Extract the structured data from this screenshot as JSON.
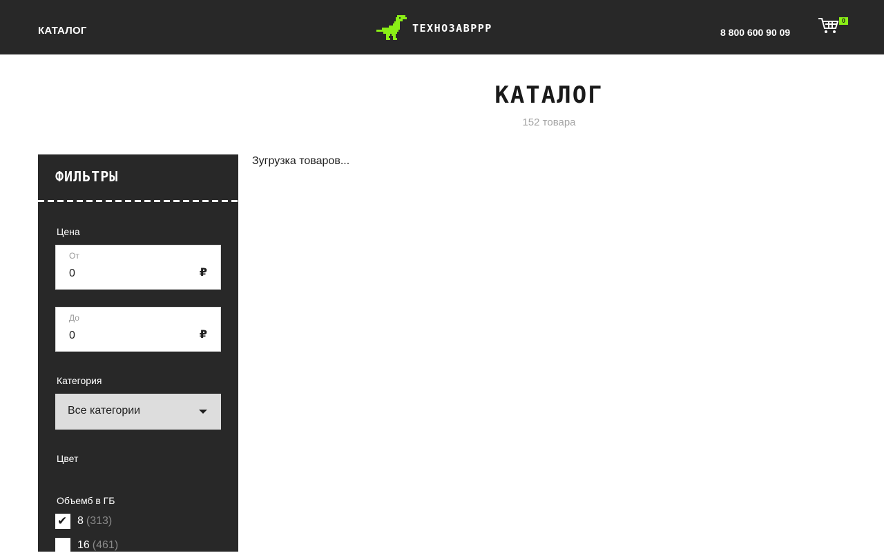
{
  "header": {
    "nav_catalog": "КАТАЛОГ",
    "logo_text": "ТЕХНОЗАВРРР",
    "logo_icon": "dinosaur-icon",
    "phone": "8 800 600 90 09",
    "cart_icon": "cart-icon",
    "cart_count": "0"
  },
  "main": {
    "title": "КАТАЛОГ",
    "count": "152 товара",
    "loading_text": "Зугрузка товаров..."
  },
  "filters": {
    "title": "ФИЛЬТРЫ",
    "price_label": "Цена",
    "price_from": {
      "caption": "От",
      "value": "0",
      "currency": "₽"
    },
    "price_to": {
      "caption": "До",
      "value": "0",
      "currency": "₽"
    },
    "category_label": "Категория",
    "category_value": "Все категории",
    "color_label": "Цвет",
    "volume_label": "Объемб в ГБ",
    "volume_options": [
      {
        "label": "8",
        "count": "(313)",
        "checked": true
      },
      {
        "label": "16",
        "count": "(461)",
        "checked": false
      }
    ]
  },
  "colors": {
    "header_bg": "#282828",
    "accent": "#8aef16",
    "select_bg": "#dddddd",
    "muted_text": "#a3a3a3"
  }
}
